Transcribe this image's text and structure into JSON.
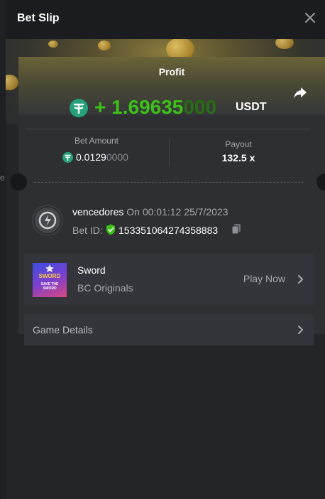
{
  "header": {
    "title": "Bet Slip"
  },
  "left_strip": {
    "fragment": "e"
  },
  "profit": {
    "label": "Profit",
    "sign": "+ ",
    "amount_main": "1.69635",
    "amount_trailing": "000",
    "currency": "USDT"
  },
  "bet_amount": {
    "label": "Bet Amount",
    "value_main": "0.0129",
    "value_trailing": "0000"
  },
  "payout": {
    "label": "Payout",
    "value": "132.5 x"
  },
  "user": {
    "name": "vencedores",
    "on_text": "On 00:01:12 25/7/2023",
    "bet_id_label": "Bet ID:",
    "bet_id": "153351064274358883"
  },
  "game": {
    "name": "Sword",
    "provider": "BC Originals",
    "play_label": "Play Now",
    "thumbnail_title": "SWORD",
    "thumbnail_sub1": "SAVE THE",
    "thumbnail_sub2": "SWORD"
  },
  "details": {
    "label": "Game Details"
  },
  "colors": {
    "profit_green": "#3bc117",
    "usdt": "#26a17b",
    "panel": "#232528"
  },
  "icons": [
    "close-icon",
    "share-icon",
    "usdt-icon",
    "shield-check-icon",
    "copy-icon",
    "chevron-right-icon"
  ]
}
